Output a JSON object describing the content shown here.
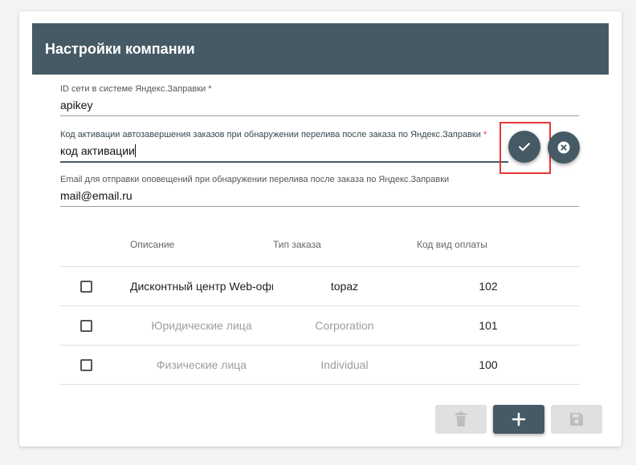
{
  "panel": {
    "title": "Настройки компании"
  },
  "fields": {
    "network_id": {
      "label": "ID сети в системе Яндекс.Заправки",
      "required_mark": "*",
      "value": "apikey"
    },
    "activation_code": {
      "label": "Код активации автозавершения заказов при обнаружении перелива после заказа по Яндекс.Заправки",
      "required_mark": "*",
      "value": "код активации"
    },
    "email": {
      "label": "Email для отправки оповещений при обнаружении перелива после заказа по Яндекс.Заправки",
      "value": "mail@email.ru"
    }
  },
  "inline_actions": {
    "confirm_icon": "check-icon",
    "cancel_icon": "close-circle-icon"
  },
  "table": {
    "headers": [
      "Описание",
      "Тип заказа",
      "Код вид оплаты"
    ],
    "rows": [
      {
        "description": "Дисконтный центр Web-офис",
        "order_type": "topaz",
        "payment_code": "102",
        "checked": false
      },
      {
        "description": "Юридические лица",
        "order_type": "Corporation",
        "payment_code": "101",
        "checked": false
      },
      {
        "description": "Физические лица",
        "order_type": "Individual",
        "payment_code": "100",
        "checked": false
      }
    ]
  },
  "actions": {
    "delete_icon": "trash-icon",
    "add_icon": "plus-icon",
    "save_icon": "save-icon"
  },
  "colors": {
    "header_bg": "#455a64",
    "accent": "#455a64",
    "highlight": "#e53935"
  }
}
